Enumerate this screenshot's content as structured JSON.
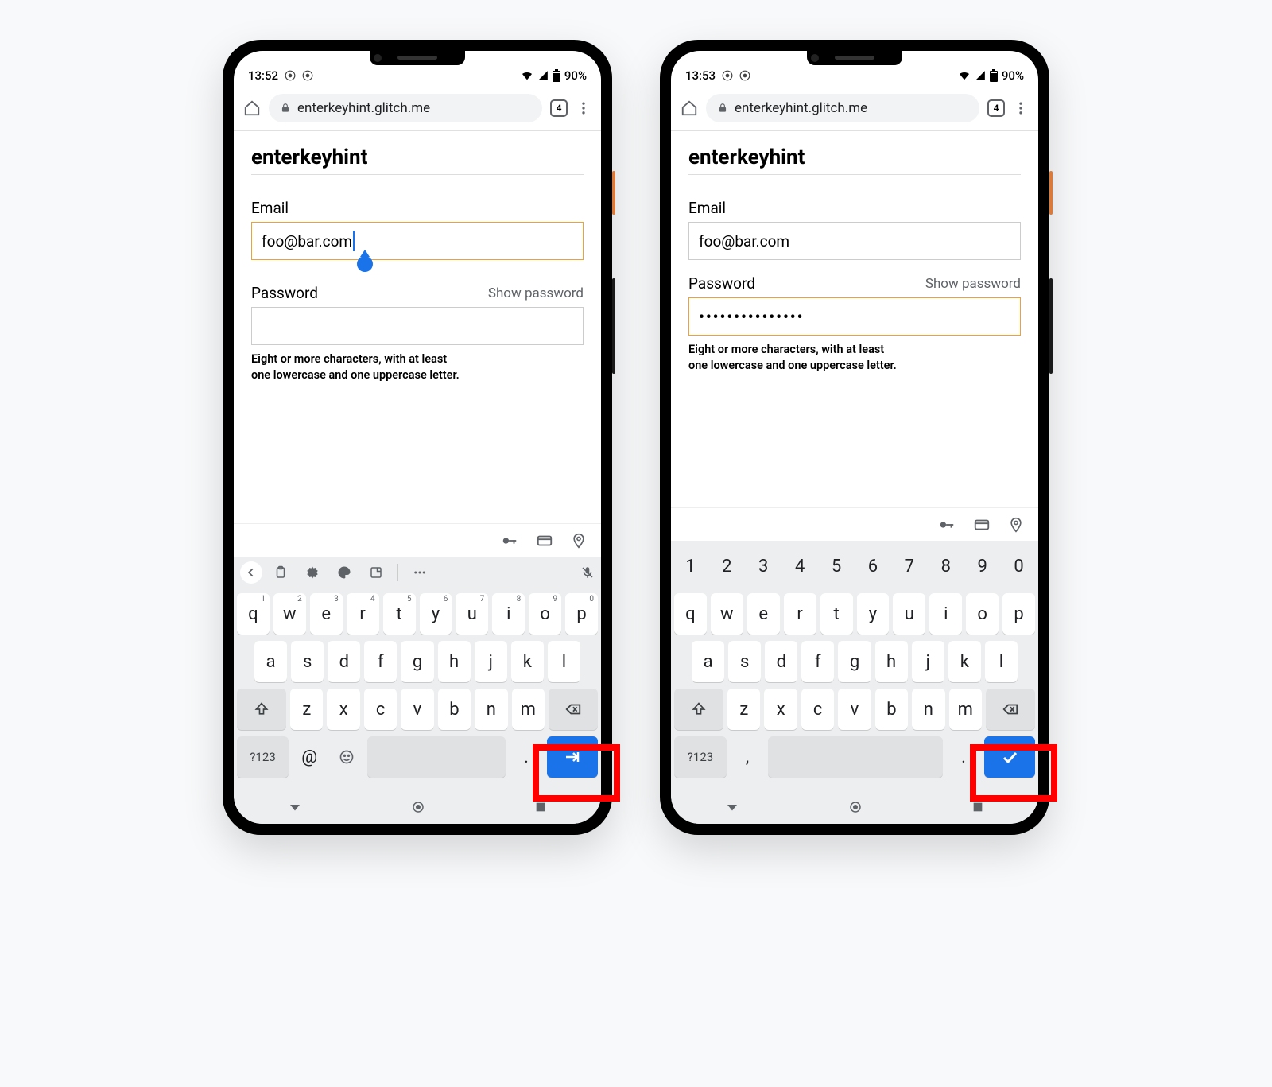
{
  "phones": [
    {
      "status": {
        "time": "13:52",
        "right_text": "90%"
      },
      "browser": {
        "url": "enterkeyhint.glitch.me",
        "tabcount": "4"
      },
      "page": {
        "title": "enterkeyhint",
        "email_label": "Email",
        "email_value": "foo@bar.com",
        "password_label": "Password",
        "show_password": "Show password",
        "password_value": "",
        "hint_line1": "Eight or more characters, with at least",
        "hint_line2": "one lowercase and one uppercase letter.",
        "focused_field": "email"
      },
      "keyboard": {
        "has_toolbar": true,
        "has_number_row": false,
        "row1": [
          {
            "k": "q",
            "s": "1"
          },
          {
            "k": "w",
            "s": "2"
          },
          {
            "k": "e",
            "s": "3"
          },
          {
            "k": "r",
            "s": "4"
          },
          {
            "k": "t",
            "s": "5"
          },
          {
            "k": "y",
            "s": "6"
          },
          {
            "k": "u",
            "s": "7"
          },
          {
            "k": "i",
            "s": "8"
          },
          {
            "k": "o",
            "s": "9"
          },
          {
            "k": "p",
            "s": "0"
          }
        ],
        "row2": [
          "a",
          "s",
          "d",
          "f",
          "g",
          "h",
          "j",
          "k",
          "l"
        ],
        "row3": [
          "z",
          "x",
          "c",
          "v",
          "b",
          "n",
          "m"
        ],
        "bottom": {
          "sym": "?123",
          "left_key": "@",
          "period": ".",
          "enter_icon": "next"
        }
      }
    },
    {
      "status": {
        "time": "13:53",
        "right_text": "90%"
      },
      "browser": {
        "url": "enterkeyhint.glitch.me",
        "tabcount": "4"
      },
      "page": {
        "title": "enterkeyhint",
        "email_label": "Email",
        "email_value": "foo@bar.com",
        "password_label": "Password",
        "show_password": "Show password",
        "password_value": "•••••••••••••••",
        "hint_line1": "Eight or more characters, with at least",
        "hint_line2": "one lowercase and one uppercase letter.",
        "focused_field": "password"
      },
      "keyboard": {
        "has_toolbar": false,
        "has_number_row": true,
        "number_row": [
          "1",
          "2",
          "3",
          "4",
          "5",
          "6",
          "7",
          "8",
          "9",
          "0"
        ],
        "row1": [
          {
            "k": "q"
          },
          {
            "k": "w"
          },
          {
            "k": "e"
          },
          {
            "k": "r"
          },
          {
            "k": "t"
          },
          {
            "k": "y"
          },
          {
            "k": "u"
          },
          {
            "k": "i"
          },
          {
            "k": "o"
          },
          {
            "k": "p"
          }
        ],
        "row2": [
          "a",
          "s",
          "d",
          "f",
          "g",
          "h",
          "j",
          "k",
          "l"
        ],
        "row3": [
          "z",
          "x",
          "c",
          "v",
          "b",
          "n",
          "m"
        ],
        "bottom": {
          "sym": "?123",
          "left_key": ",",
          "period": ".",
          "enter_icon": "done"
        }
      }
    }
  ]
}
